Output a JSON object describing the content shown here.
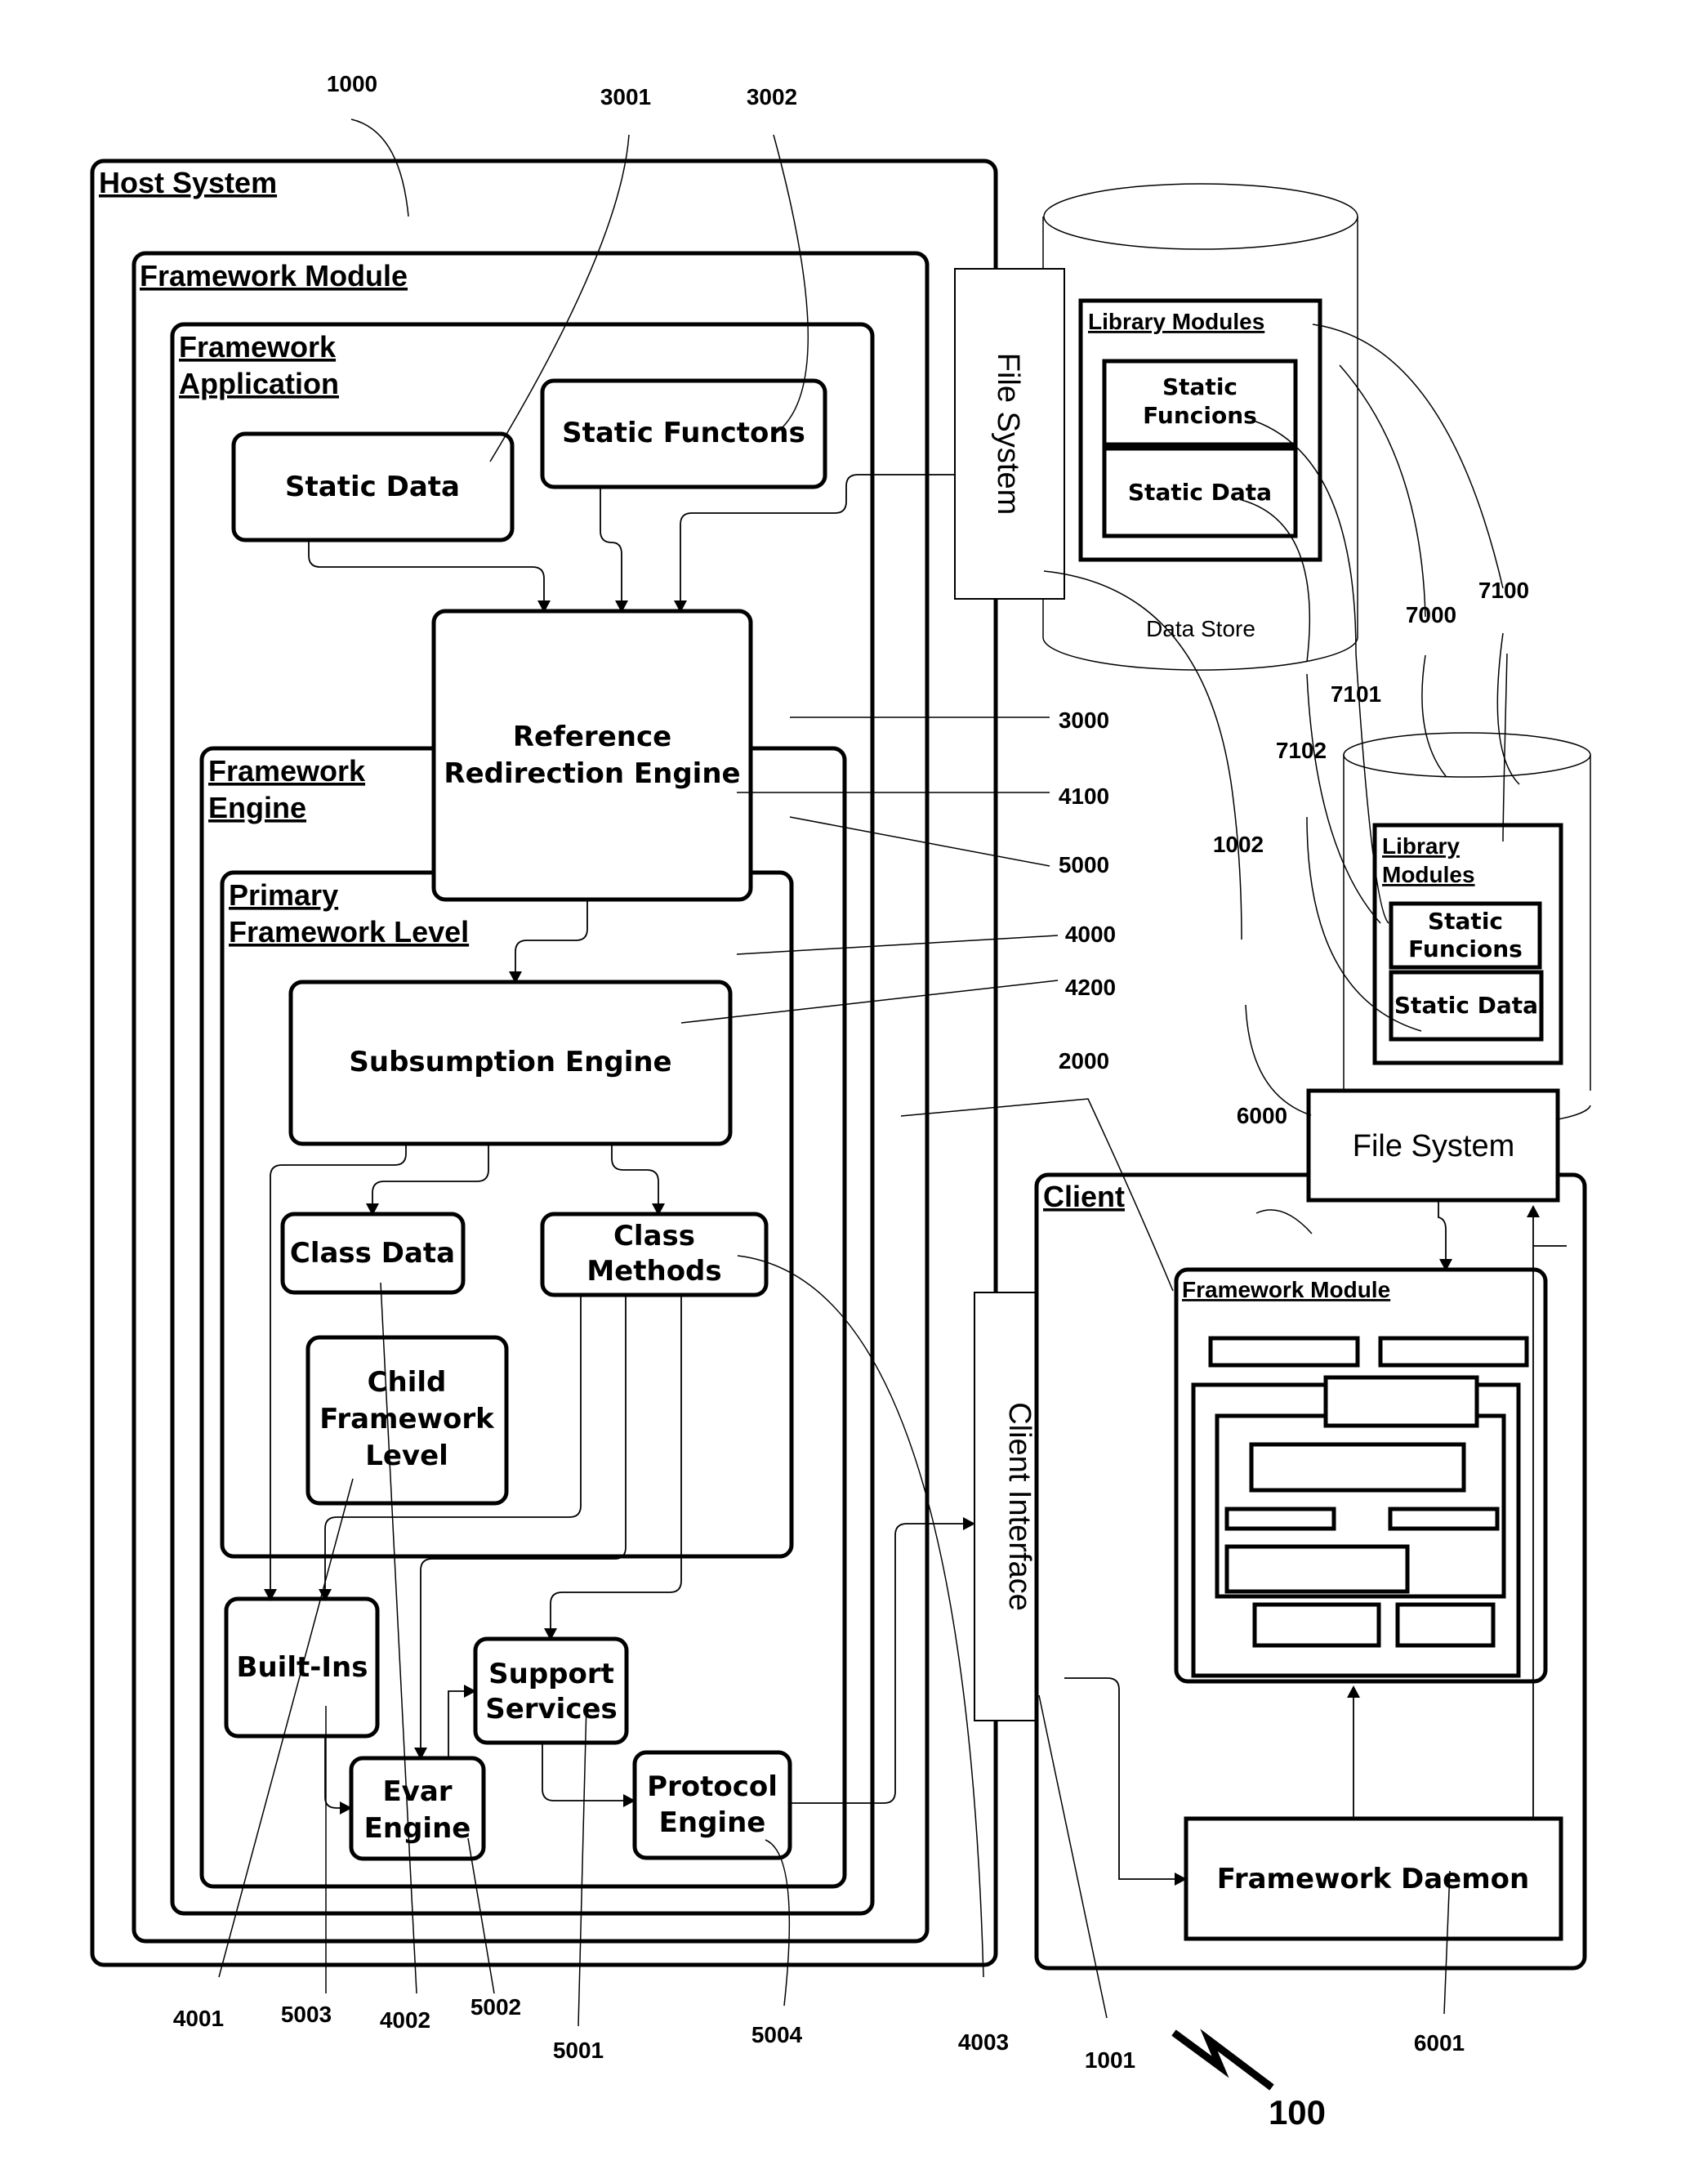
{
  "figure": {
    "figure_number": "100",
    "host_system": {
      "title": "Host System",
      "ref": "1000",
      "framework_module": {
        "title": "Framework Module",
        "ref": "2000",
        "framework_application": {
          "title_line1": "Framework",
          "title_line2": "Application",
          "ref": "3000",
          "static_data": {
            "label": "Static Data",
            "ref": "3001"
          },
          "static_functions": {
            "label": "Static Functons",
            "ref": "3002"
          }
        },
        "reference_redirection_engine": {
          "line1": "Reference",
          "line2": "Redirection Engine",
          "ref": "4100"
        },
        "framework_engine": {
          "title_line1": "Framework",
          "title_line2": "Engine",
          "ref": "5000",
          "primary_framework_level": {
            "title_line1": "Primary",
            "title_line2": "Framework Level",
            "ref": "4000",
            "subsumption_engine": {
              "label": "Subsumption Engine",
              "ref": "4200"
            },
            "class_data": {
              "label": "Class Data",
              "ref": "4002"
            },
            "class_methods": {
              "line1": "Class",
              "line2": "Methods",
              "ref": "4003"
            },
            "child_framework_level": {
              "line1": "Child",
              "line2": "Framework",
              "line3": "Level",
              "ref": "4001"
            }
          },
          "built_ins": {
            "label": "Built-Ins",
            "ref": "5003"
          },
          "support_services": {
            "line1": "Support",
            "line2": "Services",
            "ref": "5001"
          },
          "evar_engine": {
            "line1": "Evar",
            "line2": "Engine",
            "ref": "5002"
          },
          "protocol_engine": {
            "line1": "Protocol",
            "line2": "Engine",
            "ref": "5004"
          }
        }
      }
    },
    "file_system_host": {
      "label": "File System"
    },
    "client_interface": {
      "label": "Client Interface",
      "ref": "1001"
    },
    "data_store": {
      "label": "Data Store",
      "ref": "1002",
      "library_modules": {
        "title": "Library Modules",
        "ref": "7000",
        "static_functions": {
          "line1": "Static",
          "line2": "Funcions"
        },
        "static_data": {
          "label": "Static Data"
        }
      }
    },
    "client_store": {
      "library_modules": {
        "title_line1": "Library",
        "title_line2": "Modules",
        "ref": "7100",
        "static_functions": {
          "line1": "Static",
          "line2": "Funcions",
          "ref": "7101"
        },
        "static_data": {
          "label": "Static Data",
          "ref": "7102"
        }
      }
    },
    "client": {
      "title": "Client",
      "ref": "6000",
      "file_system": {
        "label": "File System"
      },
      "framework_module": {
        "title": "Framework Module"
      },
      "framework_daemon": {
        "label": "Framework Daemon",
        "ref": "6001"
      }
    }
  }
}
